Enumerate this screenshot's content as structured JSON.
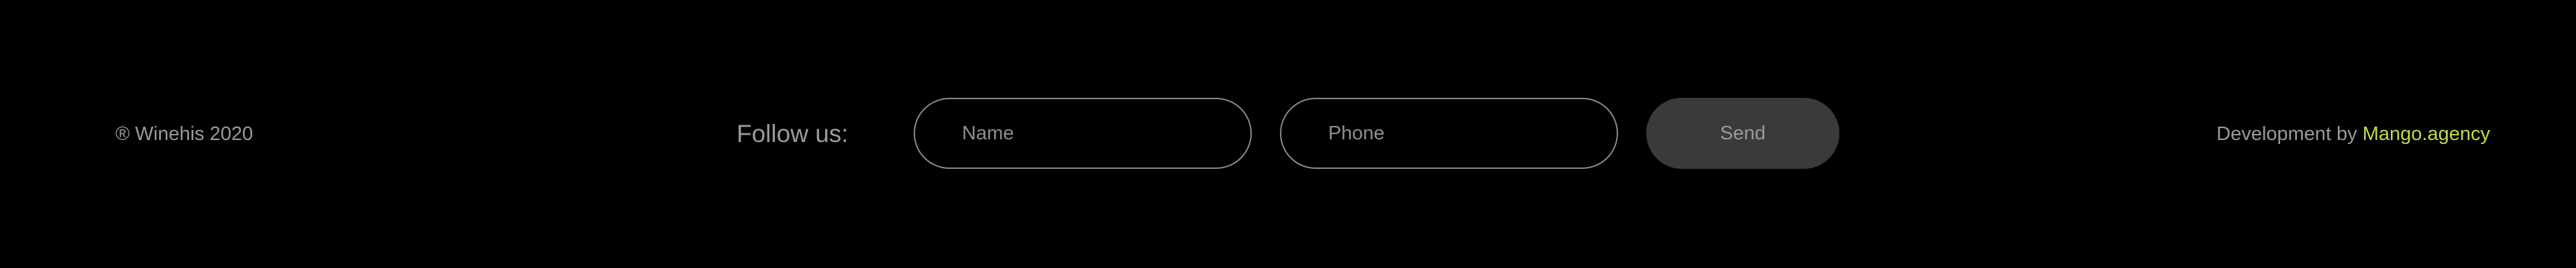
{
  "footer": {
    "copyright": "® Winehis 2020",
    "follow_label": "Follow us:",
    "form": {
      "name_placeholder": "Name",
      "phone_placeholder": "Phone",
      "send_label": "Send"
    },
    "credit": {
      "prefix": "Development by ",
      "link_text": "Mango.agency"
    }
  },
  "colors": {
    "background": "#000000",
    "text": "#9a9a9a",
    "accent": "#c3d84e",
    "button_bg": "#3a3a3a"
  }
}
